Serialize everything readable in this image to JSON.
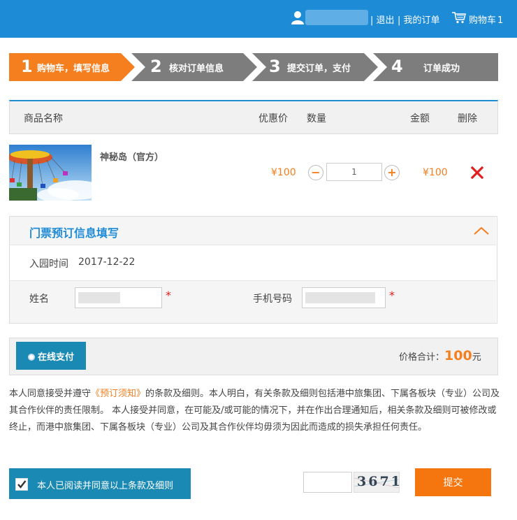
{
  "header": {
    "logout": "| 退出",
    "orders": "| 我的订单",
    "cart": "购物车",
    "cart_count": "1"
  },
  "steps": [
    {
      "num": "1",
      "label": "购物车，填写信息",
      "active": true
    },
    {
      "num": "2",
      "label": "核对订单信息",
      "active": false
    },
    {
      "num": "3",
      "label": "提交订单，支付",
      "active": false
    },
    {
      "num": "4",
      "label": "订单成功",
      "active": false
    }
  ],
  "table_head": {
    "name": "商品名称",
    "discount": "优惠价",
    "qty": "数量",
    "amount": "金额",
    "delete": "删除"
  },
  "product": {
    "name": "神秘岛（官方）",
    "price": "¥100",
    "qty": "1",
    "amount": "¥100",
    "minus": "−",
    "plus": "+"
  },
  "ticket": {
    "title": "门票预订信息填写",
    "date_label": "入园时间",
    "date_value": "2017-12-22",
    "name_label": "姓名",
    "phone_label": "手机号码",
    "required_mark": "*"
  },
  "payment": {
    "online_pay": "在线支付",
    "total_label": "价格合计：",
    "total_value": "100",
    "total_unit": "元"
  },
  "terms": {
    "part1": "本人同意接受并遵守",
    "link": "《预订须知》",
    "part2": "的条款及细则。本人明白，有关条款及细则包括港中旅集团、下属各板块（专业）公司及其合作伙伴的责任限制。 本人接受并同意，在可能及/或可能的情况下，并在作出合理通知后，相关条款及细则可被修改或终止，而港中旅集团、下属各板块（专业）公司及其合作伙伴均毋须为因此而造成的损失承担任何责任。"
  },
  "agree": {
    "label": "本人已阅读并同意以上条款及细则",
    "checked": true
  },
  "captcha": {
    "code": "3671"
  },
  "submit": "提交",
  "colors": {
    "header_blue": "#1e8bd6",
    "active_step": "#f57e1e",
    "inactive_step": "#7d7d7d",
    "price_orange": "#f57e1e",
    "delete_red": "#e02020"
  }
}
